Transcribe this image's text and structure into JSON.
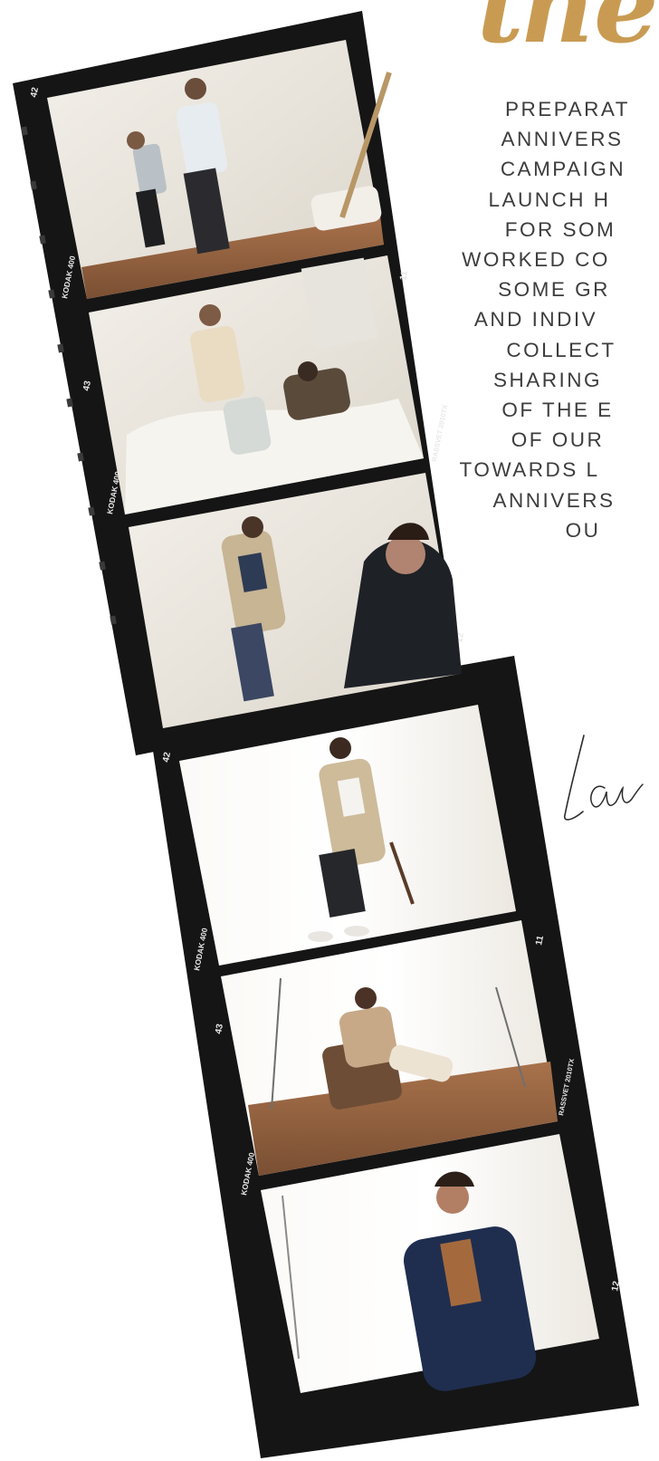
{
  "page": {
    "accent_color": "#c99b52",
    "film_color": "#151515"
  },
  "heading": {
    "text": "the"
  },
  "body_lines": [
    "Preparat",
    "Annivers",
    "campaign",
    "launch h",
    "for som",
    "worked co",
    "some gr",
    "and indiv",
    "collect",
    "sharing",
    "of the e",
    "of our",
    "towards l",
    "Annivers",
    "ou"
  ],
  "signature": {
    "text": "Lau"
  },
  "film_strip": {
    "edge_labels": [
      "42",
      "KODAK 400",
      "43",
      "RASSVET 2010TX",
      "11",
      "12"
    ],
    "frames": [
      {
        "desc": "two-people-setting-up-backdrop"
      },
      {
        "desc": "stylist-adjusting-model-shoes"
      },
      {
        "desc": "model-seated-in-trench-coat-with-photographer"
      },
      {
        "desc": "model-smiling-in-trench-coat-on-chair"
      },
      {
        "desc": "model-in-cream-outfit-on-armchair"
      },
      {
        "desc": "man-in-navy-blazer-portrait"
      }
    ]
  }
}
